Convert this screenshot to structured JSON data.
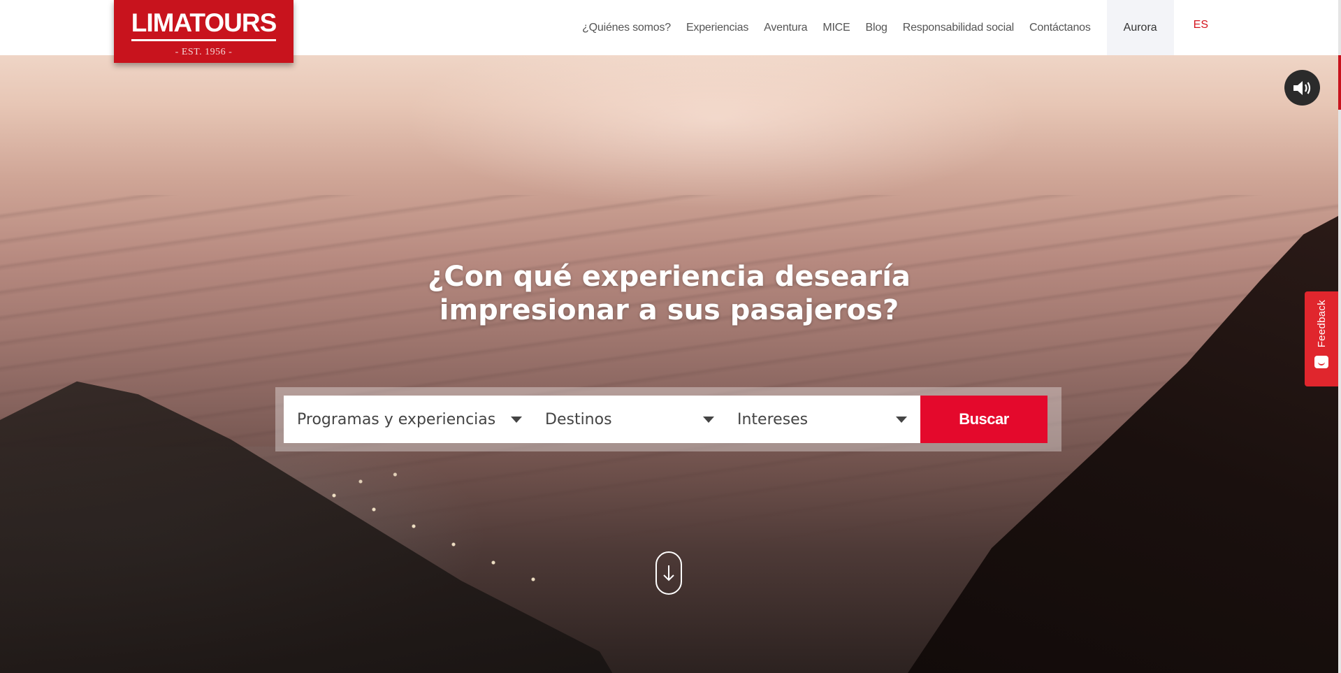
{
  "brand": {
    "name": "LIMATOURS",
    "tagline": "- EST. 1956 -",
    "color": "#c8131d"
  },
  "nav": {
    "items": [
      {
        "label": "¿Quiénes somos?"
      },
      {
        "label": "Experiencias"
      },
      {
        "label": "Aventura"
      },
      {
        "label": "MICE"
      },
      {
        "label": "Blog"
      },
      {
        "label": "Responsabilidad social"
      },
      {
        "label": "Contáctanos"
      }
    ],
    "aurora": "Aurora",
    "language": "ES"
  },
  "hero": {
    "headline_line1": "¿Con qué experiencia desearía",
    "headline_line2": "impresionar a sus pasajeros?"
  },
  "search": {
    "programas": "Programas y experiencias",
    "destinos": "Destinos",
    "intereses": "Intereses",
    "button": "Buscar",
    "button_color": "#e4092c"
  },
  "widgets": {
    "sound_icon": "speaker-icon",
    "scroll_icon": "arrow-down-icon",
    "feedback_label": "Feedback",
    "feedback_color": "#e0262d"
  }
}
